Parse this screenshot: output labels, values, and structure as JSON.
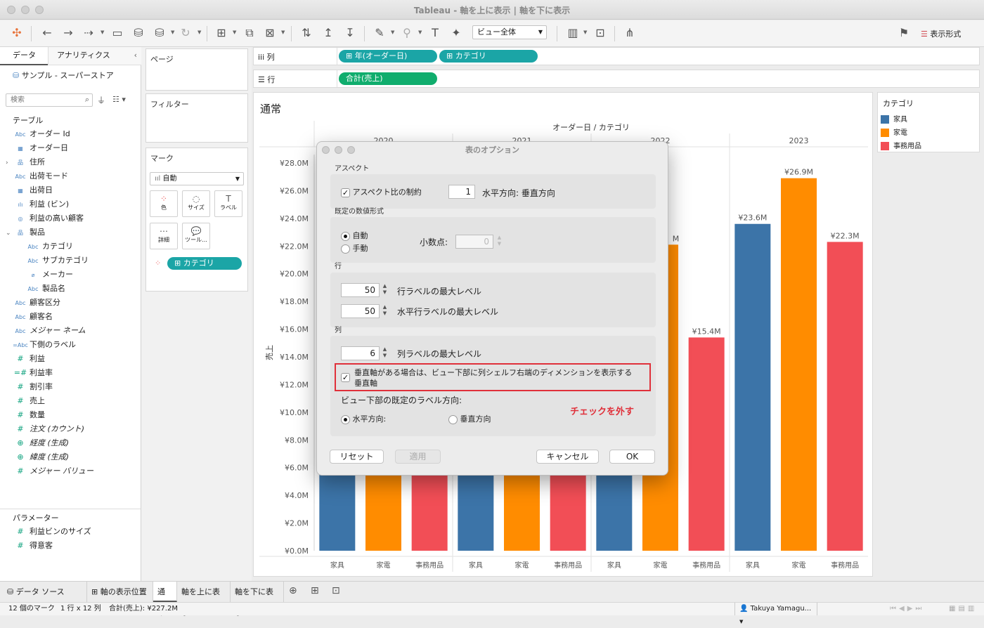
{
  "window": {
    "title": "Tableau - 軸を上に表示 | 軸を下に表示"
  },
  "toolbar": {
    "view_select": "ビュー全体",
    "show_me": "表示形式"
  },
  "left_pane": {
    "tabs": [
      "データ",
      "アナリティクス"
    ],
    "datasource": "サンプル - スーパーストア",
    "search_placeholder": "検索",
    "tables_header": "テーブル",
    "fields": [
      {
        "icon": "Abc",
        "label": "オーダー Id",
        "indent": 0
      },
      {
        "icon": "cal",
        "label": "オーダー日",
        "indent": 0
      },
      {
        "icon": "geo",
        "label": "住所",
        "indent": 0,
        "expander": ">"
      },
      {
        "icon": "Abc",
        "label": "出荷モード",
        "indent": 0
      },
      {
        "icon": "cal",
        "label": "出荷日",
        "indent": 0
      },
      {
        "icon": "bin",
        "label": "利益 (ビン)",
        "indent": 0
      },
      {
        "icon": "set",
        "label": "利益の高い顧客",
        "indent": 0
      },
      {
        "icon": "geo",
        "label": "製品",
        "indent": 0,
        "expander": "v"
      },
      {
        "icon": "Abc",
        "label": "カテゴリ",
        "indent": 1
      },
      {
        "icon": "Abc",
        "label": "サブカテゴリ",
        "indent": 1
      },
      {
        "icon": "clip",
        "label": "メーカー",
        "indent": 1
      },
      {
        "icon": "Abc",
        "label": "製品名",
        "indent": 1
      },
      {
        "icon": "Abc",
        "label": "顧客区分",
        "indent": 0
      },
      {
        "icon": "Abc",
        "label": "顧客名",
        "indent": 0
      },
      {
        "icon": "Abc",
        "label": "メジャー ネーム",
        "indent": 0,
        "italic": true
      },
      {
        "icon": "=Abc",
        "label": "下側のラベル",
        "indent": 0
      },
      {
        "icon": "#",
        "label": "利益",
        "indent": 0
      },
      {
        "icon": "=#",
        "label": "利益率",
        "indent": 0
      },
      {
        "icon": "#",
        "label": "割引率",
        "indent": 0
      },
      {
        "icon": "#",
        "label": "売上",
        "indent": 0
      },
      {
        "icon": "#",
        "label": "数量",
        "indent": 0
      },
      {
        "icon": "#",
        "label": "注文 (カウント)",
        "indent": 0,
        "italic": true
      },
      {
        "icon": "globe",
        "label": "経度 (生成)",
        "indent": 0,
        "italic": true
      },
      {
        "icon": "globe",
        "label": "緯度 (生成)",
        "indent": 0,
        "italic": true
      },
      {
        "icon": "#",
        "label": "メジャー バリュー",
        "indent": 0,
        "italic": true
      }
    ],
    "params_header": "パラメーター",
    "params": [
      "利益ビンのサイズ",
      "得意客"
    ]
  },
  "mid_pane": {
    "pages": "ページ",
    "filters": "フィルター",
    "marks": "マーク",
    "mark_type": "自動",
    "mark_buttons": [
      "色",
      "サイズ",
      "ラベル",
      "詳細",
      "ツール..."
    ],
    "mark_pill": "カテゴリ"
  },
  "shelves": {
    "columns_label": "列",
    "rows_label": "行",
    "column_pills": [
      "年(オーダー日)",
      "カテゴリ"
    ],
    "row_pills": [
      "合計(売上)"
    ]
  },
  "sheet": {
    "title": "通常",
    "header": "オーダー日 / カテゴリ",
    "ylabel": "売上"
  },
  "legend": {
    "title": "カテゴリ",
    "items": [
      {
        "label": "家具",
        "color": "#3c74a8"
      },
      {
        "label": "家電",
        "color": "#ff8c00"
      },
      {
        "label": "事務用品",
        "color": "#f24e56"
      }
    ]
  },
  "chart_data": {
    "type": "bar",
    "ylabel": "売上",
    "ylim": [
      0,
      28.0
    ],
    "yticks": [
      "¥0.0M",
      "¥2.0M",
      "¥4.0M",
      "¥6.0M",
      "¥8.0M",
      "¥10.0M",
      "¥12.0M",
      "¥14.0M",
      "¥16.0M",
      "¥18.0M",
      "¥20.0M",
      "¥22.0M",
      "¥24.0M",
      "¥26.0M",
      "¥28.0M"
    ],
    "years": [
      "2020",
      "2021",
      "2022",
      "2023"
    ],
    "categories": [
      "家具",
      "家電",
      "事務用品"
    ],
    "series": [
      {
        "name": "家具",
        "values": [
          null,
          null,
          null,
          23.6
        ]
      },
      {
        "name": "家電",
        "values": [
          null,
          null,
          22.1,
          26.9
        ]
      },
      {
        "name": "事務用品",
        "values": [
          null,
          null,
          15.4,
          22.3
        ]
      }
    ],
    "value_labels": [
      "¥23.6M",
      "¥26.9M",
      "¥22.3M",
      "¥15.4M",
      "M"
    ]
  },
  "dialog": {
    "title": "表のオプション",
    "aspect": {
      "section": "アスペクト",
      "checkbox": "アスペクト比の制約",
      "value": "1",
      "desc": "水平方向: 垂直方向"
    },
    "number": {
      "section": "既定の数値形式",
      "auto": "自動",
      "manual": "手動",
      "decimals_label": "小数点:",
      "decimals": "0"
    },
    "rows": {
      "section": "行",
      "max_row": "50",
      "max_row_label": "行ラベルの最大レベル",
      "max_hrow": "50",
      "max_hrow_label": "水平行ラベルの最大レベル"
    },
    "cols": {
      "section": "列",
      "max_col": "6",
      "max_col_label": "列ラベルの最大レベル",
      "vaxis_cb_line1": "垂直軸がある場合は、ビュー下部に列シェルフ右端のディメンションを表示する",
      "vaxis_cb_line2": "垂直軸",
      "orient_label": "ビュー下部の既定のラベル方向:",
      "horiz": "水平方向:",
      "vert": "垂直方向"
    },
    "annotation": "チェックを外す",
    "buttons": {
      "reset": "リセット",
      "apply": "適用",
      "cancel": "キャンセル",
      "ok": "OK"
    }
  },
  "bottom": {
    "datasource": "データ ソース",
    "tabs": [
      "軸の表示位置",
      "通常",
      "軸を上に表示",
      "軸を下に表示"
    ]
  },
  "status": {
    "marks": "12 個のマーク",
    "rows": "1 行 x 12 列",
    "sum": "合計(売上): ¥227.2M",
    "user": "Takuya Yamagu..."
  }
}
